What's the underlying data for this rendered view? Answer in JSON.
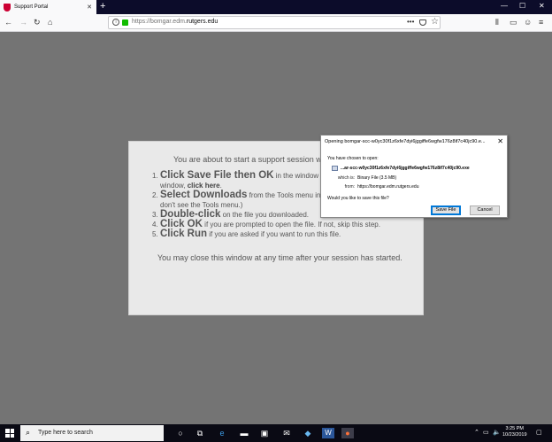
{
  "browser": {
    "tab_title": "Support Portal",
    "new_tab_label": "+",
    "url_prefix": "https://bomgar.edm.",
    "url_domain": "rutgers.edu",
    "window_controls": [
      "—",
      "☐",
      "✕"
    ]
  },
  "page": {
    "intro": "You are about to start a support session wit",
    "steps": [
      {
        "num": "1.",
        "bold": "Click Save File then OK",
        "text": " in the window tha",
        "cont_pre": "window, ",
        "cont_link": "click here",
        "cont_post": "."
      },
      {
        "num": "2.",
        "bold": "Select Downloads",
        "text": " from the Tools menu in F",
        "cont": "don't see the Tools menu.)"
      },
      {
        "num": "3.",
        "bold": "Double-click",
        "text": " on the file you downloaded."
      },
      {
        "num": "4.",
        "bold": "Click OK",
        "text": " if you are prompted to open the file. If not, skip this step."
      },
      {
        "num": "5.",
        "bold": "Click Run",
        "text": " if you are asked if you want to run this file."
      }
    ],
    "closing_note": "You may close this window at any time after your session has started."
  },
  "dialog": {
    "title": "Opening bomgar-scc-w0yc30f1z6xfe7dyi6jggiffe6wgfw176z8if7c40jc90.e...",
    "close": "✕",
    "chosen_text": "You have chosen to open:",
    "file_name": "...ar-scc-w0yc30f1z6xfe7dyi6jggiffe6wgfw176z8if7c40jc90.exe",
    "which_is_label": "which is:",
    "which_is_value": "Binary File (3.5 MB)",
    "from_label": "from:",
    "from_value": "https://bomgar.edm.rutgers.edu",
    "question": "Would you like to save this file?",
    "save_button": "Save File",
    "cancel_button": "Cancel"
  },
  "taskbar": {
    "search_placeholder": "Type here to search",
    "time": "3:25 PM",
    "date": "10/23/2019"
  },
  "colors": {
    "page_background": "#747474",
    "panel_background": "#e9e9e9",
    "tab_accent": "#cc0033",
    "lock_green": "#12bc00",
    "button_focus": "#0078d7"
  }
}
